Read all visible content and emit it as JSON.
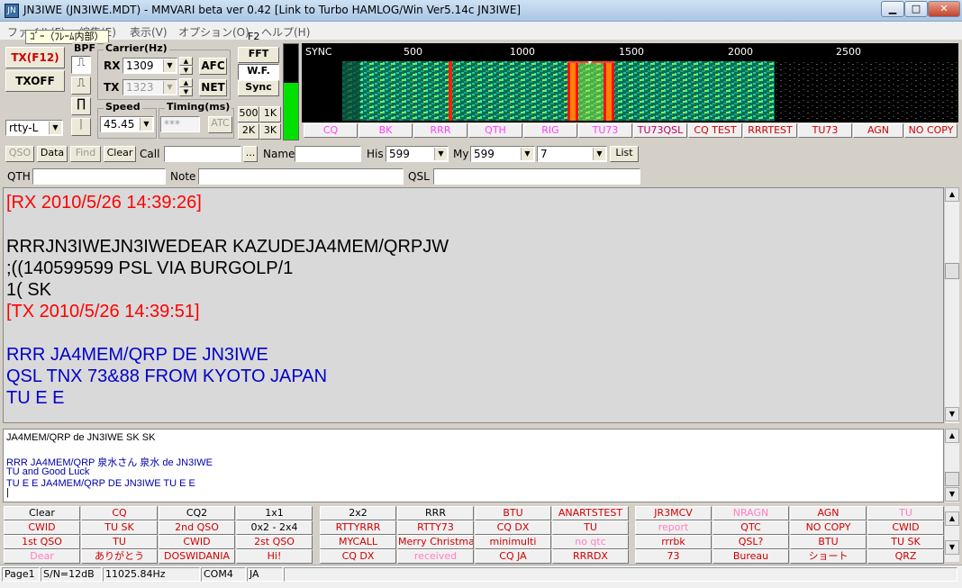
{
  "titlebar": {
    "title": "JN3IWE (JN3IWE.MDT) - MMVARI beta ver 0.42 [Link to Turbo HAMLOG/Win Ver5.14c JN3IWE]",
    "app_icon": "JN"
  },
  "menubar": {
    "items": [
      "ファイル(F)",
      "編集(E)",
      "表示(V)",
      "オプション(O)",
      "ヘルプ(H)"
    ],
    "tooltip": "ｺﾞｰ（ﾌﾚｰﾑ内部）"
  },
  "controls": {
    "tx_label": "TX(F12)",
    "txoff_label": "TXOFF",
    "bpf_label": "BPF",
    "mode_value": "rtty-L",
    "carrier_label": "Carrier(Hz)",
    "rx_label": "RX",
    "rx_value": "1309",
    "tx_sub_label": "TX",
    "tx_value": "1323",
    "afc_label": "AFC",
    "net_label": "NET",
    "speed_label": "Speed",
    "speed_value": "45.45",
    "timing_label": "Timing(ms)",
    "timing_value": "***",
    "atc_label": "ATC",
    "f2_label": "F2",
    "fft_label": "FFT",
    "wf_label": "W.F.",
    "sync_label": "Sync",
    "z500": "500",
    "z1k": "1K",
    "z2k": "2K",
    "z3k": "3K"
  },
  "spectrum": {
    "sync": "SYNC",
    "ticks": [
      "500",
      "1000",
      "1500",
      "2000",
      "2500"
    ]
  },
  "macro_row_top": [
    "CQ",
    "BK",
    "RRR",
    "QTH",
    "RIG",
    "TU73",
    "TU73QSL",
    "CQ TEST",
    "RRRTEST",
    "TU73",
    "AGN",
    "NO COPY"
  ],
  "qso_bar": {
    "qso": "QSO",
    "data": "Data",
    "find": "Find",
    "clear": "Clear",
    "call": "Call",
    "call_value": "",
    "browse": "...",
    "name": "Name",
    "name_value": "",
    "his": "His",
    "his_value": "599",
    "my": "My",
    "my_value": "599",
    "extra_value": "7",
    "list": "List",
    "qth": "QTH",
    "note": "Note",
    "qsl": "QSL"
  },
  "rx_text": [
    {
      "text": "[RX 2010/5/26 14:39:26]",
      "color": "#ff0000"
    },
    {
      "text": "",
      "color": "#000000"
    },
    {
      "text": "RRRJN3IWEJN3IWEDEAR KAZUDEJA4MEM/QRPJW",
      "color": "#000000"
    },
    {
      "text": ";((140599599  PSL VIA BURGOLP/1",
      "color": "#000000"
    },
    {
      "text": "1( SK",
      "color": "#000000"
    },
    {
      "text": "[TX 2010/5/26 14:39:51]",
      "color": "#ff0000"
    },
    {
      "text": "",
      "color": "#000000"
    },
    {
      "text": "RRR JA4MEM/QRP  DE JN3IWE",
      "color": "#0000cc"
    },
    {
      "text": "QSL TNX 73&88  FROM KYOTO JAPAN",
      "color": "#0000cc"
    },
    {
      "text": "TU E E",
      "color": "#0000cc"
    }
  ],
  "tx_text": [
    {
      "text": "JA4MEM/QRP de JN3IWE SK SK",
      "color": "#000000"
    },
    {
      "text": "",
      "color": "#000000"
    },
    {
      "text": "RRR JA4MEM/QRP 泉水さん 泉水 de JN3IWE",
      "color": "#0000aa"
    },
    {
      "text": "TU and Good Luck",
      "color": "#0000aa"
    },
    {
      "text": "TU E E JA4MEM/QRP DE JN3IWE TU E E",
      "color": "#0000aa"
    },
    {
      "text": "|",
      "color": "#000000"
    }
  ],
  "macros_left": [
    [
      {
        "t": "Clear",
        "c": "#000000"
      },
      {
        "t": "CQ",
        "c": "#d00000"
      },
      {
        "t": "CQ2",
        "c": "#000000"
      },
      {
        "t": "1x1",
        "c": "#000000"
      }
    ],
    [
      {
        "t": "CWID",
        "c": "#d00000"
      },
      {
        "t": "TU SK",
        "c": "#d00000"
      },
      {
        "t": "2nd QSO",
        "c": "#d00000"
      },
      {
        "t": "0x2 - 2x4",
        "c": "#000000"
      }
    ],
    [
      {
        "t": "1st QSO",
        "c": "#d00000"
      },
      {
        "t": "TU",
        "c": "#d00000"
      },
      {
        "t": "CWID",
        "c": "#d00000"
      },
      {
        "t": "2st QSO",
        "c": "#d00000"
      }
    ],
    [
      {
        "t": "Dear",
        "c": "#ff80c0"
      },
      {
        "t": "ありがとう",
        "c": "#d00000"
      },
      {
        "t": "DOSWIDANIA",
        "c": "#d00000"
      },
      {
        "t": "Hi!",
        "c": "#d00000"
      }
    ]
  ],
  "macros_mid": [
    [
      {
        "t": "2x2",
        "c": "#000000"
      },
      {
        "t": "RRR",
        "c": "#000000"
      },
      {
        "t": "BTU",
        "c": "#d00000"
      },
      {
        "t": "ANARTSTEST",
        "c": "#d00000"
      }
    ],
    [
      {
        "t": "RTTYRRR",
        "c": "#d00000"
      },
      {
        "t": "RTTY73",
        "c": "#d00000"
      },
      {
        "t": "CQ DX",
        "c": "#d00000"
      },
      {
        "t": "TU",
        "c": "#d00000"
      }
    ],
    [
      {
        "t": "MYCALL",
        "c": "#d00000"
      },
      {
        "t": "Merry Christmas",
        "c": "#d00000"
      },
      {
        "t": "minimulti",
        "c": "#d00000"
      },
      {
        "t": "no qtc",
        "c": "#ff80c0"
      }
    ],
    [
      {
        "t": "CQ DX",
        "c": "#d00000"
      },
      {
        "t": "received",
        "c": "#ff80c0"
      },
      {
        "t": "CQ JA",
        "c": "#d00000"
      },
      {
        "t": "RRRDX",
        "c": "#d00000"
      }
    ]
  ],
  "macros_right": [
    [
      {
        "t": "JR3MCV",
        "c": "#d00000"
      },
      {
        "t": "NRAGN",
        "c": "#ff80c0"
      },
      {
        "t": "AGN",
        "c": "#d00000"
      },
      {
        "t": "TU",
        "c": "#ff80c0"
      }
    ],
    [
      {
        "t": "report",
        "c": "#ff80c0"
      },
      {
        "t": "QTC",
        "c": "#d00000"
      },
      {
        "t": "NO COPY",
        "c": "#d00000"
      },
      {
        "t": "CWID",
        "c": "#d00000"
      }
    ],
    [
      {
        "t": "rrrbk",
        "c": "#d00000"
      },
      {
        "t": "QSL?",
        "c": "#d00000"
      },
      {
        "t": "BTU",
        "c": "#d00000"
      },
      {
        "t": "TU SK",
        "c": "#d00000"
      }
    ],
    [
      {
        "t": "73",
        "c": "#d00000"
      },
      {
        "t": "Bureau",
        "c": "#d00000"
      },
      {
        "t": "ショート",
        "c": "#d00000"
      },
      {
        "t": "QRZ",
        "c": "#d00000"
      }
    ]
  ],
  "statusbar": {
    "page": "Page1",
    "sn": "S/N=12dB",
    "freq": "11025.84Hz",
    "com": "COM4",
    "lang": "JA"
  }
}
